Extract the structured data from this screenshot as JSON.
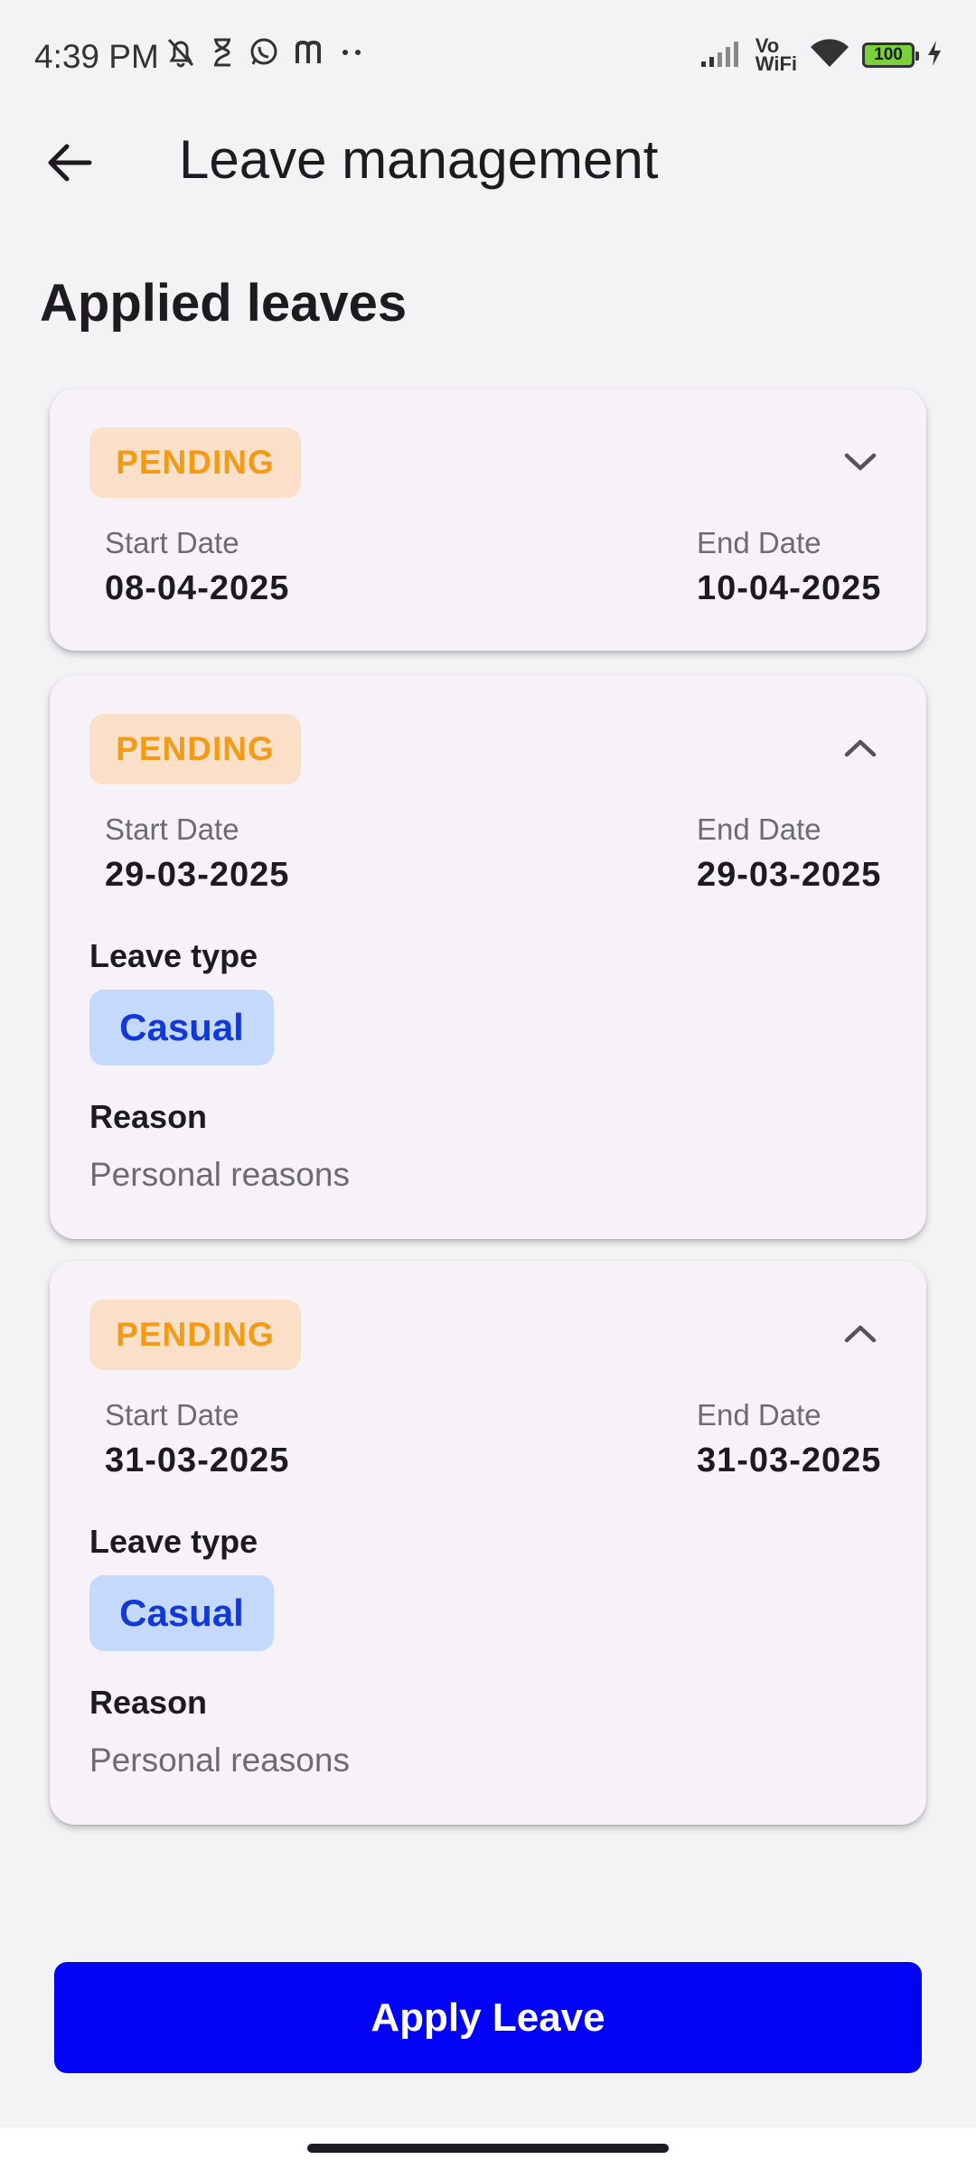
{
  "status_bar": {
    "time": "4:39 PM",
    "left_icons": [
      "bell-off-icon",
      "hourglass-icon",
      "whatsapp-icon",
      "m-app-icon",
      "more-dots-icon"
    ],
    "vo_wifi": [
      "Vo",
      "WiFi"
    ],
    "battery": "100"
  },
  "app_bar": {
    "title": "Leave management",
    "back_icon": "arrow-left-icon"
  },
  "section_title": "Applied leaves",
  "leaves": [
    {
      "status": "PENDING",
      "expanded": false,
      "start_label": "Start Date",
      "start_date": "08-04-2025",
      "end_label": "End Date",
      "end_date": "10-04-2025"
    },
    {
      "status": "PENDING",
      "expanded": true,
      "start_label": "Start Date",
      "start_date": "29-03-2025",
      "end_label": "End Date",
      "end_date": "29-03-2025",
      "type_label": "Leave type",
      "type": "Casual",
      "reason_label": "Reason",
      "reason": "Personal reasons"
    },
    {
      "status": "PENDING",
      "expanded": true,
      "start_label": "Start Date",
      "start_date": "31-03-2025",
      "end_label": "End Date",
      "end_date": "31-03-2025",
      "type_label": "Leave type",
      "type": "Casual",
      "reason_label": "Reason",
      "reason": "Personal reasons"
    }
  ],
  "apply_button": "Apply Leave",
  "colors": {
    "pending_text": "#f39a17",
    "pending_bg": "#fae0c8",
    "type_text": "#1238d8",
    "type_bg": "#c4d9fc",
    "primary_button": "#0202f5",
    "card_bg": "#f6f2f8"
  }
}
